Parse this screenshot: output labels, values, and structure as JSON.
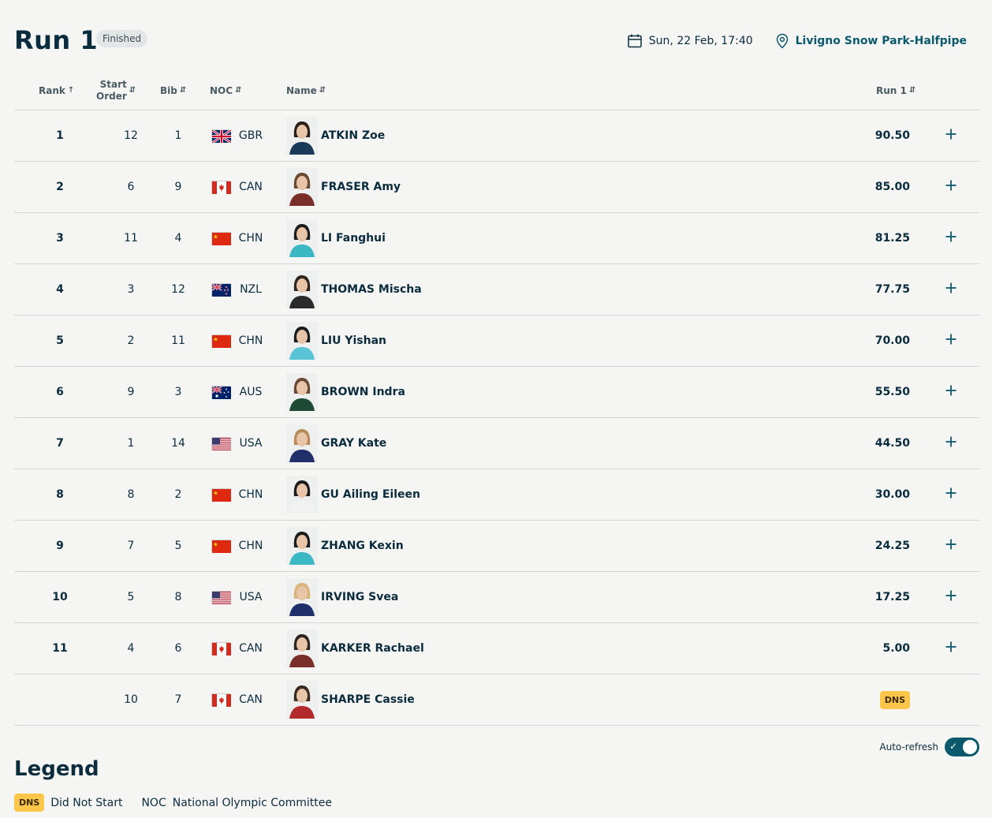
{
  "header": {
    "title": "Run 1",
    "status": "Finished",
    "date": "Sun, 22 Feb, 17:40",
    "venue": "Livigno Snow Park-Halfpipe"
  },
  "columns": {
    "rank": "Rank",
    "start_line1": "Start",
    "start_line2": "Order",
    "bib": "Bib",
    "noc": "NOC",
    "name": "Name",
    "run1": "Run 1"
  },
  "rows": [
    {
      "rank": "1",
      "start": "12",
      "bib": "1",
      "noc": "GBR",
      "name": "ATKIN Zoe",
      "score": "90.50"
    },
    {
      "rank": "2",
      "start": "6",
      "bib": "9",
      "noc": "CAN",
      "name": "FRASER Amy",
      "score": "85.00"
    },
    {
      "rank": "3",
      "start": "11",
      "bib": "4",
      "noc": "CHN",
      "name": "LI Fanghui",
      "score": "81.25"
    },
    {
      "rank": "4",
      "start": "3",
      "bib": "12",
      "noc": "NZL",
      "name": "THOMAS Mischa",
      "score": "77.75"
    },
    {
      "rank": "5",
      "start": "2",
      "bib": "11",
      "noc": "CHN",
      "name": "LIU Yishan",
      "score": "70.00"
    },
    {
      "rank": "6",
      "start": "9",
      "bib": "3",
      "noc": "AUS",
      "name": "BROWN Indra",
      "score": "55.50"
    },
    {
      "rank": "7",
      "start": "1",
      "bib": "14",
      "noc": "USA",
      "name": "GRAY Kate",
      "score": "44.50"
    },
    {
      "rank": "8",
      "start": "8",
      "bib": "2",
      "noc": "CHN",
      "name": "GU Ailing Eileen",
      "score": "30.00"
    },
    {
      "rank": "9",
      "start": "7",
      "bib": "5",
      "noc": "CHN",
      "name": "ZHANG Kexin",
      "score": "24.25"
    },
    {
      "rank": "10",
      "start": "5",
      "bib": "8",
      "noc": "USA",
      "name": "IRVING Svea",
      "score": "17.25"
    },
    {
      "rank": "11",
      "start": "4",
      "bib": "6",
      "noc": "CAN",
      "name": "KARKER Rachael",
      "score": "5.00"
    },
    {
      "rank": "",
      "start": "10",
      "bib": "7",
      "noc": "CAN",
      "name": "SHARPE Cassie",
      "score": "DNS"
    }
  ],
  "autorefresh": {
    "label": "Auto-refresh",
    "on": true
  },
  "legend": {
    "title": "Legend",
    "dns_abbr": "DNS",
    "dns_text": "Did Not Start",
    "noc_abbr": "NOC",
    "noc_text": "National Olympic Committee"
  },
  "icons": {
    "date": "calendar-icon",
    "venue": "location-pin-icon",
    "expand": "plus-icon",
    "sort": "sort-icon"
  },
  "colors": {
    "accent": "#0b5a6c",
    "dns": "#fcc64a",
    "text": "#0b2c3d"
  }
}
